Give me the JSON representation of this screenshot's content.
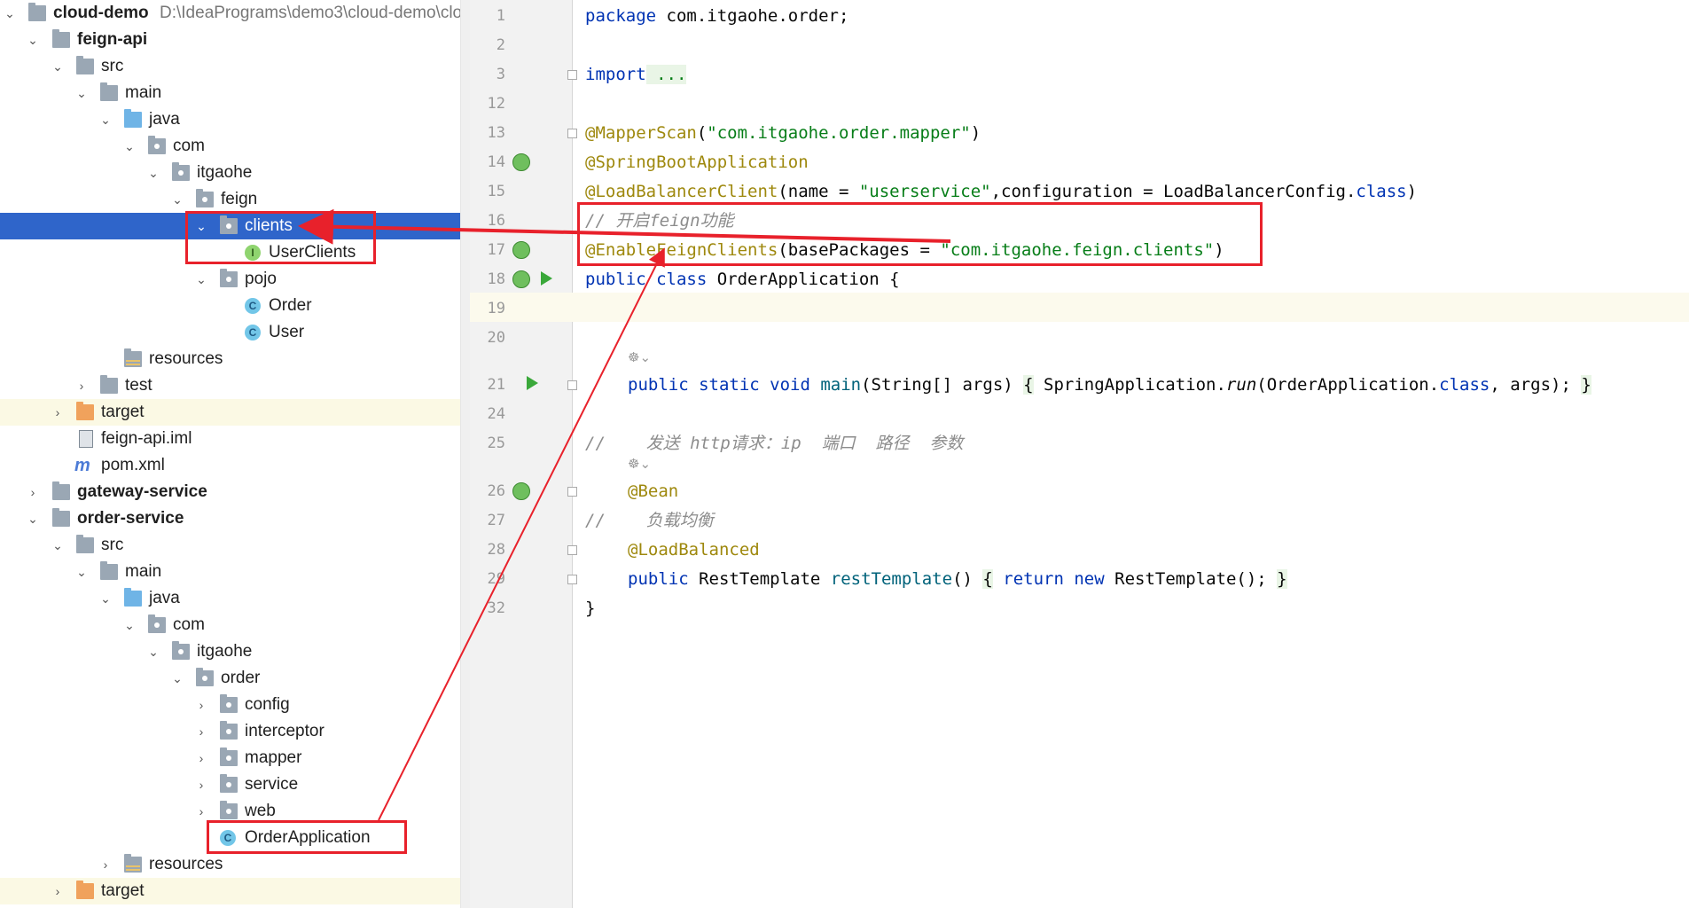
{
  "tree": {
    "rows": [
      {
        "label": "cloud-demo",
        "path": "D:\\IdeaPrograms\\demo3\\cloud-demo\\clo"
      },
      {
        "label": "feign-api"
      },
      {
        "label": "src"
      },
      {
        "label": "main"
      },
      {
        "label": "java"
      },
      {
        "label": "com"
      },
      {
        "label": "itgaohe"
      },
      {
        "label": "feign"
      },
      {
        "label": "clients"
      },
      {
        "label": "UserClients"
      },
      {
        "label": "pojo"
      },
      {
        "label": "Order"
      },
      {
        "label": "User"
      },
      {
        "label": "resources"
      },
      {
        "label": "test"
      },
      {
        "label": "target"
      },
      {
        "label": "feign-api.iml"
      },
      {
        "label": "pom.xml"
      },
      {
        "label": "gateway-service"
      },
      {
        "label": "order-service"
      },
      {
        "label": "src"
      },
      {
        "label": "main"
      },
      {
        "label": "java"
      },
      {
        "label": "com"
      },
      {
        "label": "itgaohe"
      },
      {
        "label": "order"
      },
      {
        "label": "config"
      },
      {
        "label": "interceptor"
      },
      {
        "label": "mapper"
      },
      {
        "label": "service"
      },
      {
        "label": "web"
      },
      {
        "label": "OrderApplication"
      },
      {
        "label": "resources"
      },
      {
        "label": "target"
      }
    ]
  },
  "editor": {
    "line_numbers": [
      "1",
      "2",
      "3",
      "12",
      "13",
      "14",
      "15",
      "16",
      "17",
      "18",
      "19",
      "20",
      "21",
      "24",
      "25",
      "26",
      "27",
      "28",
      "29",
      "32"
    ],
    "lines": {
      "l1_kw": "package",
      "l1_rest": " com.itgaohe.order;",
      "l3_kw": "import",
      "l3_fold": " ...",
      "l13_an": "@MapperScan",
      "l13_a": "(",
      "l13_str": "\"com.itgaohe.order.mapper\"",
      "l13_b": ")",
      "l14_an": "@SpringBootApplication",
      "l15_an": "@LoadBalancerClient",
      "l15_a": "(name = ",
      "l15_str": "\"userservice\"",
      "l15_b": ",configuration = LoadBalancerConfig.",
      "l15_kw": "class",
      "l15_c": ")",
      "l16_cm": "// 开启feign功能",
      "l17_an": "@EnableFeignClients",
      "l17_a": "(basePackages = ",
      "l17_str": "\"com.itgaohe.feign.clients\"",
      "l17_b": ")",
      "l18_kw1": "public",
      "l18_kw2": " class",
      "l18_rest": " OrderApplication {",
      "l21_kw": "public static void",
      "l21_fn": " main",
      "l21_a": "(String[] args) ",
      "l21_b": "{",
      "l21_c": " SpringApplication.",
      "l21_it": "run",
      "l21_d": "(OrderApplication.",
      "l21_kw2": "class",
      "l21_e": ", args); ",
      "l21_f": "}",
      "l25_cm": "//    发送 http请求：ip  端口  路径  参数",
      "l26_an": "@Bean",
      "l27_cm": "//    负载均衡",
      "l28_an": "@LoadBalanced",
      "l29_kw": "public",
      "l29_a": " RestTemplate ",
      "l29_fn": "restTemplate",
      "l29_b": "() ",
      "l29_c": "{",
      "l29_kw2": " return new",
      "l29_d": " RestTemplate(); ",
      "l29_e": "}",
      "l32": "}"
    },
    "hints": [
      "☸⌄",
      "☸⌄"
    ]
  },
  "colors": {
    "selection": "#2f65ca",
    "annotation_red": "#e8212b",
    "keyword": "#0033b3",
    "annotation": "#9e880d",
    "string": "#067d17"
  }
}
